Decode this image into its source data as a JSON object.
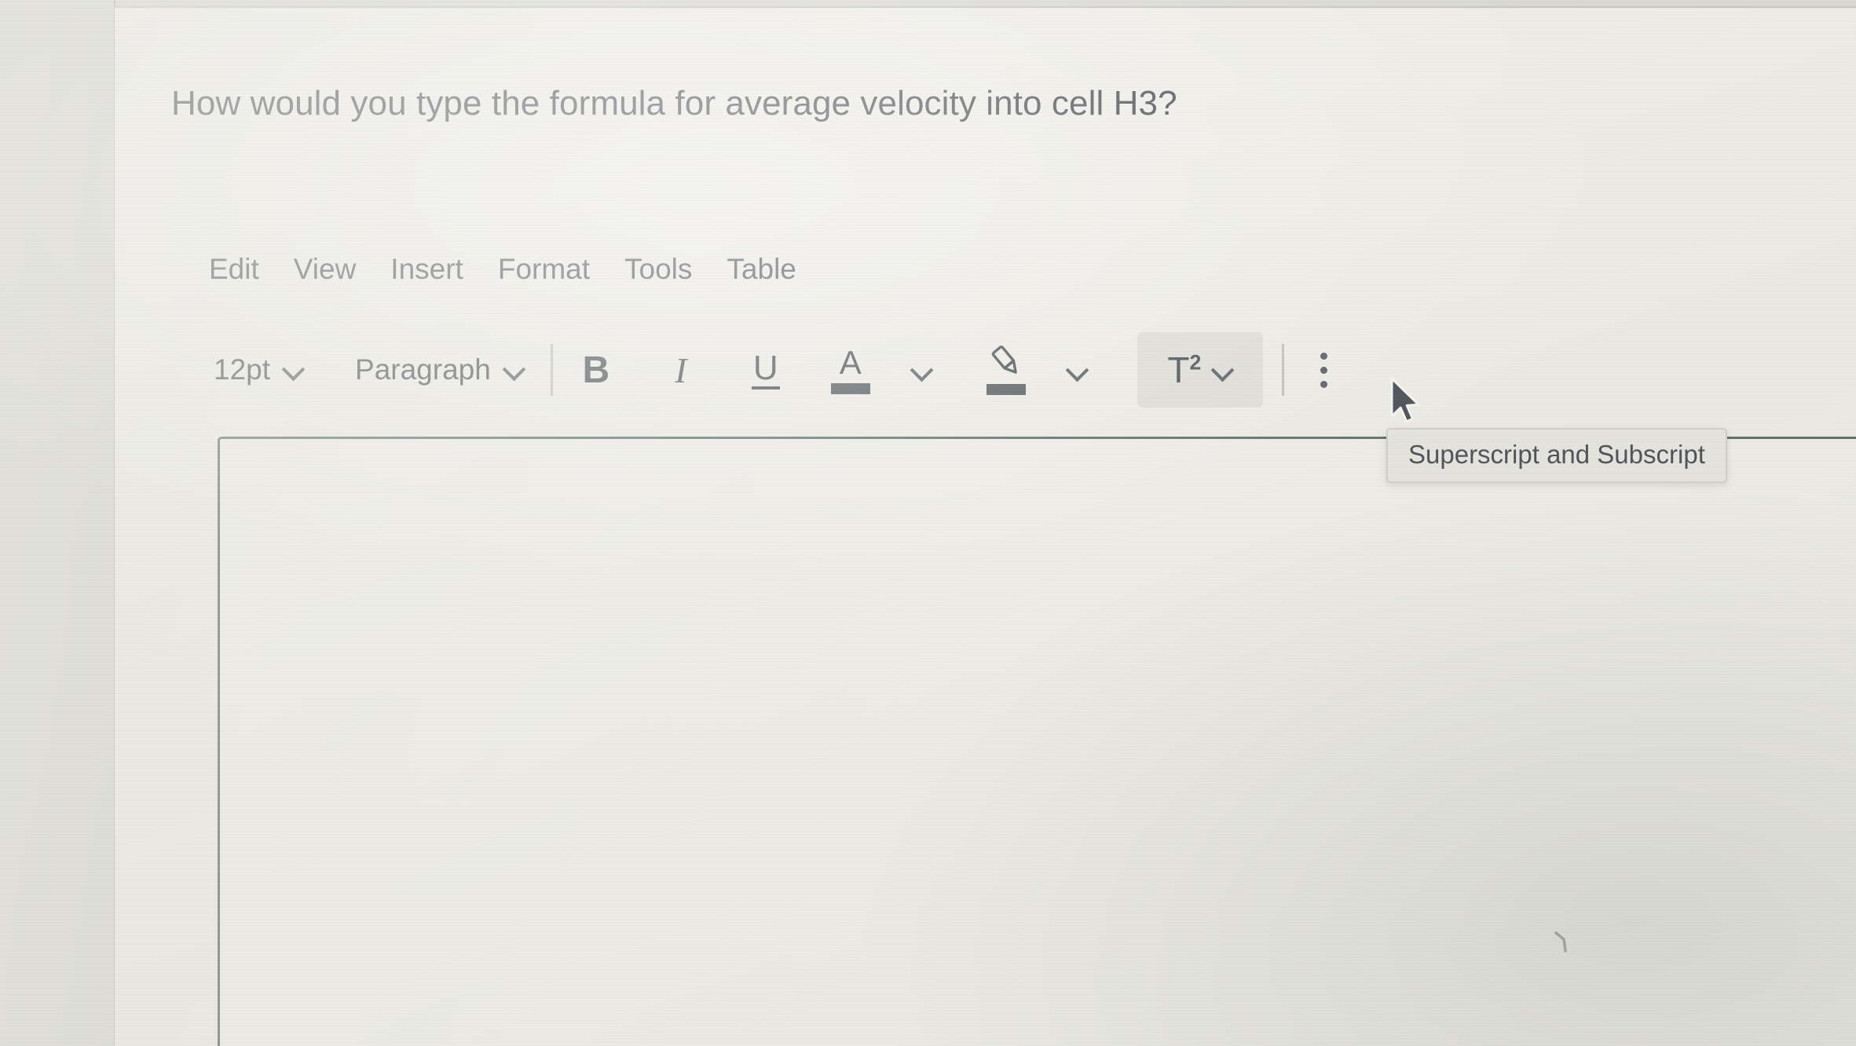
{
  "question": {
    "text": "How would you type the formula for average velocity into cell H3?"
  },
  "editor": {
    "menubar": [
      {
        "label": "Edit"
      },
      {
        "label": "View"
      },
      {
        "label": "Insert"
      },
      {
        "label": "Format"
      },
      {
        "label": "Tools"
      },
      {
        "label": "Table"
      }
    ],
    "toolbar": {
      "font_size": {
        "value": "12pt",
        "chevron_icon": "chevron-down-icon"
      },
      "block_format": {
        "value": "Paragraph",
        "chevron_icon": "chevron-down-icon"
      },
      "bold_label": "B",
      "italic_label": "I",
      "underline_label": "U",
      "text_color": {
        "letter": "A",
        "swatch_color": "#565c62",
        "chevron_icon": "chevron-down-icon"
      },
      "highlight": {
        "icon": "highlighter-pen-icon",
        "swatch_color": "#565c62",
        "chevron_icon": "chevron-down-icon"
      },
      "superscript": {
        "label": "T",
        "exponent": "2",
        "chevron_icon": "chevron-down-icon",
        "state": "hovered"
      },
      "overflow_icon": "kebab-menu-icon"
    },
    "content": ""
  },
  "tooltip": {
    "text": "Superscript and Subscript"
  },
  "cursor": {
    "icon": "mouse-arrow-pointer"
  },
  "colors": {
    "text": "#4b5157",
    "border": "#62706f",
    "page_bg": "#efeee9",
    "hover_bg": "#dedcd6",
    "tooltip_bg": "#e4e3de"
  }
}
